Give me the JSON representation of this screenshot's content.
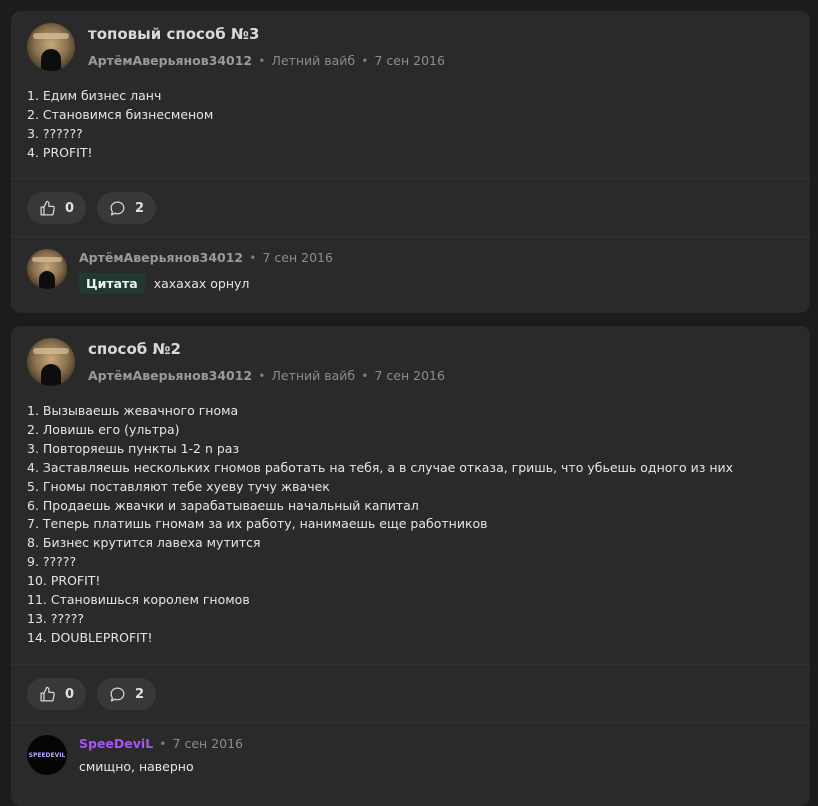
{
  "posts": [
    {
      "title": "топовый способ №3",
      "author": "АртёмАверьянов34012",
      "channel": "Летний вайб",
      "date": "7 сен 2016",
      "lines": [
        "1. Едим бизнес ланч",
        "2. Становимся бизнесменом",
        "3. ??????",
        "4. PROFIT!"
      ],
      "likes": "0",
      "comments": "2",
      "comment": {
        "author": "АртёмАверьянов34012",
        "date": "7 сен 2016",
        "quote_label": "Цитата",
        "text": "хахахах орнул"
      }
    },
    {
      "title": "способ №2",
      "author": "АртёмАверьянов34012",
      "channel": "Летний вайб",
      "date": "7 сен 2016",
      "lines": [
        "1. Вызываешь жевачного гнома",
        "2. Ловишь его (ультра)",
        "3. Повторяешь пункты 1-2 n раз",
        "4. Заставляешь нескольких гномов работать на тебя, а в случае отказа, гришь, что убьешь одного из них",
        "5. Гномы поставляют тебе хуеву тучу жвачек",
        "6. Продаешь жвачки и зарабатываешь начальный капитал",
        "7. Теперь платишь гномам за их работу, нанимаешь еще работников",
        "8. Бизнес крутится лавеха мутится",
        "9. ?????",
        "10. PROFIT!",
        "11. Становишься королем гномов",
        "13. ?????",
        "14. DOUBLEPROFIT!"
      ],
      "likes": "0",
      "comments": "2",
      "comment": {
        "author": "SpeeDeviL",
        "date": "7 сен 2016",
        "text": "смищно, наверно",
        "avatar_text": "SPEEDEVIL"
      }
    }
  ],
  "colors": {
    "background": "#1c1c1c",
    "card": "#2a2a2a",
    "pill": "#383838",
    "quote_tag": "#203a32",
    "accent_purple": "#a855f7"
  },
  "icons": {
    "like": "thumbs-up-icon",
    "comments": "speech-bubble-icon",
    "dot": "•"
  }
}
